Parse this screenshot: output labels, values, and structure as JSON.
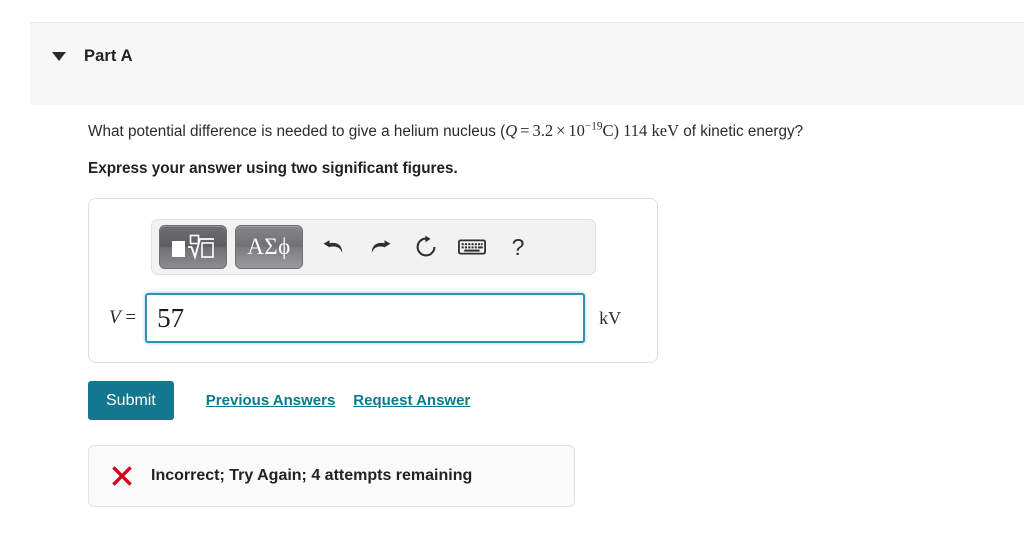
{
  "part": {
    "caret_icon": "caret-down-icon",
    "title": "Part A"
  },
  "question": {
    "text_before": "What potential difference is needed to give a helium nucleus (",
    "math": {
      "variable": "Q",
      "equals": "=",
      "coefficient": "3.2",
      "times": "×",
      "base": "10",
      "exponent": "−19",
      "unit": "C"
    },
    "text_middle": ") 114",
    "energy_unit": "keV",
    "text_after": "of kinetic energy?",
    "instruction": "Express your answer using two significant figures."
  },
  "toolbar": {
    "template_button": {
      "name": "math-template-button",
      "label": "■ ⁿ√□"
    },
    "greek_button": {
      "name": "greek-symbols-button",
      "label": "ΑΣϕ"
    },
    "undo_icon": "undo-icon",
    "redo_icon": "redo-icon",
    "reset_icon": "reset-icon",
    "keyboard_icon": "keyboard-icon",
    "help_label": "?"
  },
  "answer": {
    "label_variable": "V",
    "label_equals": "=",
    "value": "57",
    "placeholder": "",
    "unit": "kV"
  },
  "actions": {
    "submit_label": "Submit",
    "previous_answers_label": "Previous Answers",
    "request_answer_label": "Request Answer"
  },
  "feedback": {
    "icon": "incorrect-x-icon",
    "message": "Incorrect; Try Again; 4 attempts remaining"
  },
  "colors": {
    "accent_teal": "#12778f",
    "link_teal": "#0f7792",
    "input_border": "#2c93b2",
    "error_red": "#d6001c",
    "header_band": "#f7f7f7"
  }
}
